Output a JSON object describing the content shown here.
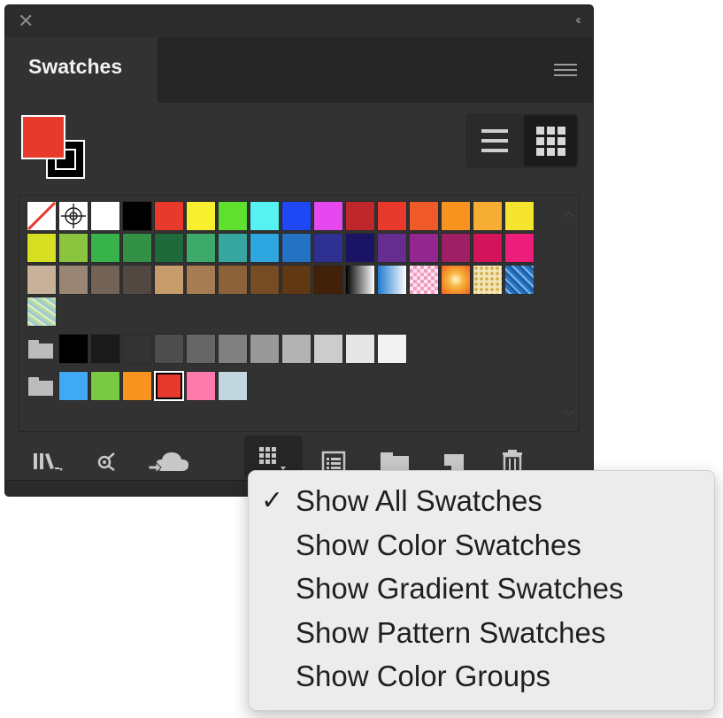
{
  "panel": {
    "title": "Swatches",
    "close_glyph": "✕",
    "collapse_glyph": "‹‹"
  },
  "fill_color": "#e8392d",
  "swatch_rows": [
    [
      "none",
      "registration",
      "#ffffff",
      "#000000",
      "#e8392d",
      "#f8ef2e",
      "#5fe02f",
      "#56f2f2",
      "#1e47f5",
      "#e648f0",
      "#c0272d",
      "#e8392d",
      "#f05a28",
      "#f7931e",
      "#f6ad34",
      "#f5e52f"
    ],
    [
      "#d7df23",
      "#8bc53f",
      "#38b24a",
      "#339146",
      "#1f6a3b",
      "#3daa6b",
      "#36a7a0",
      "#2ea7e0",
      "#2571c4",
      "#2e3192",
      "#1b1464",
      "#662d91",
      "#93278f",
      "#9e1f63",
      "#d4145a",
      "#ed1e79"
    ],
    [
      "#c7b299",
      "#998675",
      "#736357",
      "#534741",
      "#c69c6d",
      "#a67c52",
      "#8c6239",
      "#754c24",
      "#603813",
      "#42210b",
      "gradient-bw",
      "gradient-blue",
      "pattern-pink",
      "gradient-orange",
      "pattern-dots",
      "pattern-blue"
    ],
    [
      "pattern-leaves"
    ]
  ],
  "group_grays": [
    "#000000",
    "#1a1a1a",
    "#333333",
    "#4d4d4d",
    "#666666",
    "#808080",
    "#999999",
    "#b3b3b3",
    "#cccccc",
    "#e6e6e6",
    "#f2f2f2"
  ],
  "group_colors": [
    "#3fa9f5",
    "#7ac943",
    "#f7931e",
    "#e8392d",
    "#ff7bac",
    "#c2d6e0"
  ],
  "selected_swatch": "#e8392d",
  "bottom_icons": [
    "library-icon",
    "place-swatch-icon",
    "cloud-icon",
    "show-kind-menu-icon",
    "options-icon",
    "new-group-icon",
    "new-swatch-icon",
    "trash-icon"
  ],
  "menu": {
    "checkmark": "✓",
    "items": [
      {
        "label": "Show All Swatches",
        "checked": true
      },
      {
        "label": "Show Color Swatches",
        "checked": false
      },
      {
        "label": "Show Gradient Swatches",
        "checked": false
      },
      {
        "label": "Show Pattern Swatches",
        "checked": false
      },
      {
        "label": "Show Color Groups",
        "checked": false
      }
    ]
  }
}
